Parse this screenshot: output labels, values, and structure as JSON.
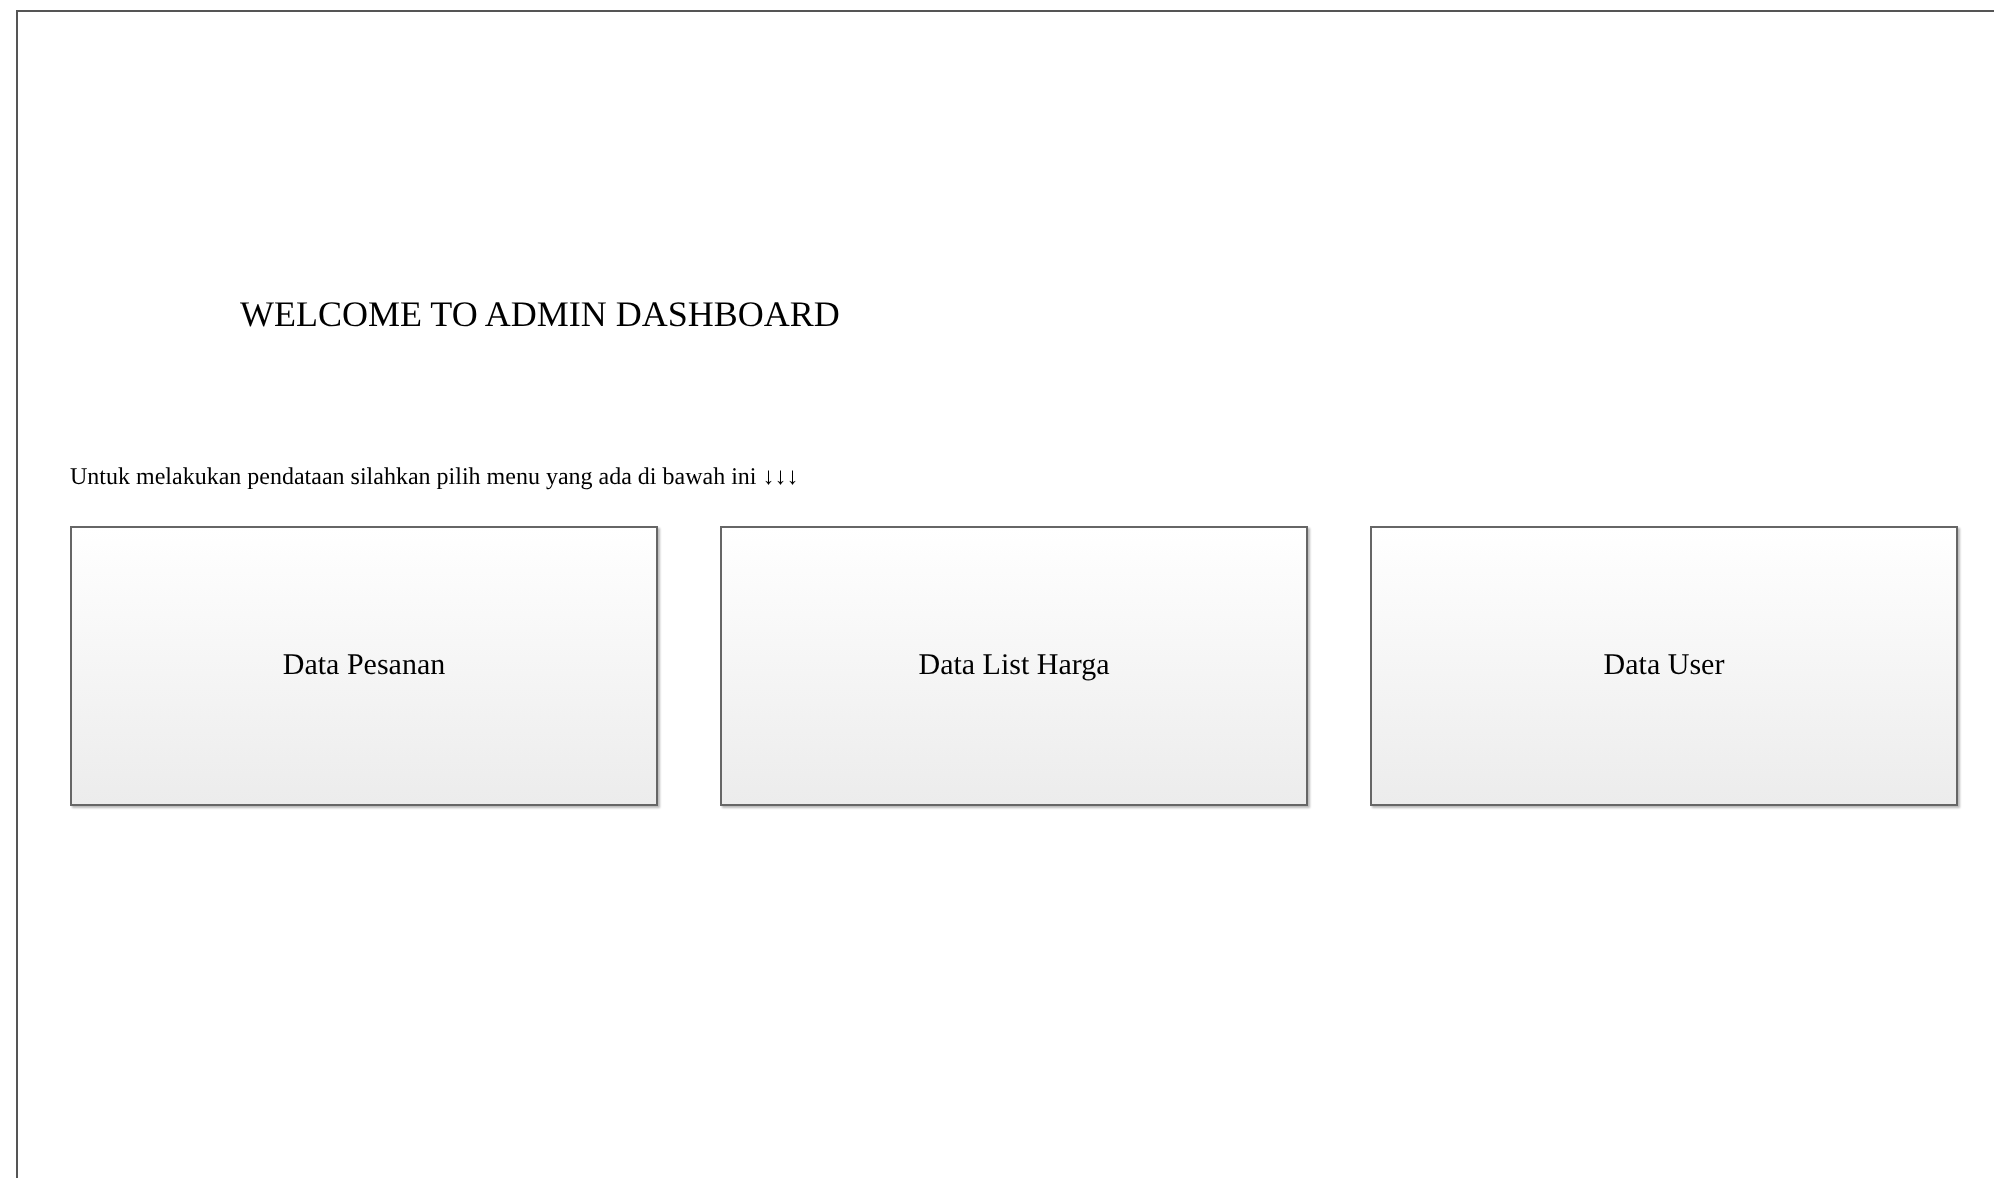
{
  "heading": "WELCOME TO ADMIN DASHBOARD",
  "instruction": "Untuk melakukan pendataan silahkan pilih menu yang ada di bawah ini ↓↓↓",
  "menu_buttons": [
    "Data Pesanan",
    "Data List Harga",
    "Data User"
  ]
}
